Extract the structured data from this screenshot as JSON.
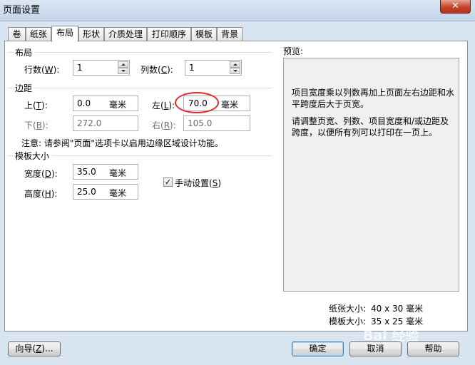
{
  "window": {
    "title": "页面设置",
    "close_label": "✕"
  },
  "tabs": [
    "卷",
    "纸张",
    "布局",
    "形状",
    "介质处理",
    "打印顺序",
    "模板",
    "背景"
  ],
  "layout_group": {
    "title": "布局",
    "rows_label": "行数(",
    "rows_key": "W",
    "rows_close": "):",
    "rows_value": "1",
    "cols_label": "列数(",
    "cols_key": "C",
    "cols_close": "):",
    "cols_value": "1"
  },
  "margins_group": {
    "title": "边距",
    "top_label": "上(",
    "top_key": "T",
    "top_close": "):",
    "top_value": "0.0",
    "top_unit": "毫米",
    "left_label": "左(",
    "left_key": "L",
    "left_close": "):",
    "left_value": "70.0",
    "left_unit": "毫米",
    "bottom_label": "下(",
    "bottom_key": "B",
    "bottom_close": "):",
    "bottom_value": "272.0",
    "right_label": "右(",
    "right_key": "R",
    "right_close": "):",
    "right_value": "105.0",
    "note": "注意: 请参阅\"页面\"选项卡以启用边缘区域设计功能。"
  },
  "template_size_group": {
    "title": "模板大小",
    "width_label": "宽度(",
    "width_key": "D",
    "width_close": "):",
    "width_value": "35.0",
    "width_unit": "毫米",
    "height_label": "高度(",
    "height_key": "H",
    "height_close": "):",
    "height_value": "25.0",
    "height_unit": "毫米",
    "manual_label": "手动设置(",
    "manual_key": "S",
    "manual_close": ")",
    "manual_checked": true
  },
  "preview": {
    "title": "预览:",
    "message_1": "项目宽度乘以列数再加上页面左右边距和水平跨度后大于页宽。",
    "message_2": "请调整页宽、列数、项目宽度和/或边距及跨度，以便所有列可以打印在一页上。",
    "paper_size_label": "纸张大小:",
    "paper_size_value": "40 x 30 毫米",
    "template_size_label": "模板大小:",
    "template_size_value": "35 x 25 毫米"
  },
  "buttons": {
    "wizard_label": "向导(",
    "wizard_key": "Z",
    "wizard_close": ")...",
    "ok": "确定",
    "cancel": "取消",
    "help": "帮助"
  },
  "watermark": "Bai 经验"
}
